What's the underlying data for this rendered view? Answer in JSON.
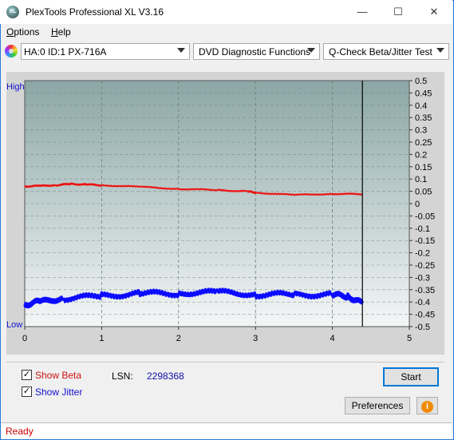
{
  "window": {
    "title": "PlexTools Professional XL V3.16",
    "app_icon_text": "XL",
    "minimize": "—",
    "maximize": "☐",
    "close": "✕"
  },
  "menu": {
    "items": [
      {
        "label": "Options"
      },
      {
        "label": "Help"
      }
    ]
  },
  "toolbar": {
    "drive": "HA:0 ID:1  PX-716A",
    "function": "DVD Diagnostic Functions",
    "test": "Q-Check Beta/Jitter Test"
  },
  "colors": {
    "beta": "#ee1111",
    "jitter": "#0b0bff",
    "axis_label": "#1010cc",
    "plot_top": "#8ba6a6",
    "plot_bottom": "#f4f6f6",
    "status_text": "#cc0000"
  },
  "chart_data": {
    "type": "line",
    "xlim": [
      0,
      5
    ],
    "x_ticks": [
      "0",
      "1",
      "2",
      "3",
      "4",
      "5"
    ],
    "ylim": [
      -0.5,
      0.5
    ],
    "y_ticks": [
      "0.5",
      "0.45",
      "0.4",
      "0.35",
      "0.3",
      "0.25",
      "0.2",
      "0.15",
      "0.1",
      "0.05",
      "0",
      "-0.05",
      "-0.1",
      "-0.15",
      "-0.2",
      "-0.25",
      "-0.3",
      "-0.35",
      "-0.4",
      "-0.45",
      "-0.5"
    ],
    "y_left_high": "High",
    "y_left_low": "Low",
    "grid": true,
    "end_marker_x": 4.39,
    "series": [
      {
        "name": "Beta",
        "x": [
          0,
          0.2,
          0.4,
          0.6,
          0.8,
          1.0,
          1.5,
          2.0,
          2.5,
          2.9,
          3.0,
          3.5,
          4.0,
          4.39
        ],
        "y": [
          0.07,
          0.072,
          0.075,
          0.08,
          0.078,
          0.075,
          0.068,
          0.06,
          0.055,
          0.05,
          0.045,
          0.035,
          0.04,
          0.038
        ]
      },
      {
        "name": "Jitter",
        "x": [
          0,
          0.2,
          0.5,
          1.0,
          1.5,
          2.0,
          2.5,
          3.0,
          3.5,
          4.0,
          4.2,
          4.39
        ],
        "y": [
          -0.41,
          -0.4,
          -0.385,
          -0.375,
          -0.365,
          -0.365,
          -0.36,
          -0.37,
          -0.37,
          -0.37,
          -0.375,
          -0.405
        ]
      }
    ]
  },
  "controls": {
    "show_beta": "Show Beta",
    "show_beta_checked": true,
    "show_jitter": "Show Jitter",
    "show_jitter_checked": true,
    "lsn_label": "LSN:",
    "lsn_value": "2298368",
    "start": "Start",
    "preferences": "Preferences",
    "info_icon": "i"
  },
  "status": {
    "text": "Ready"
  }
}
